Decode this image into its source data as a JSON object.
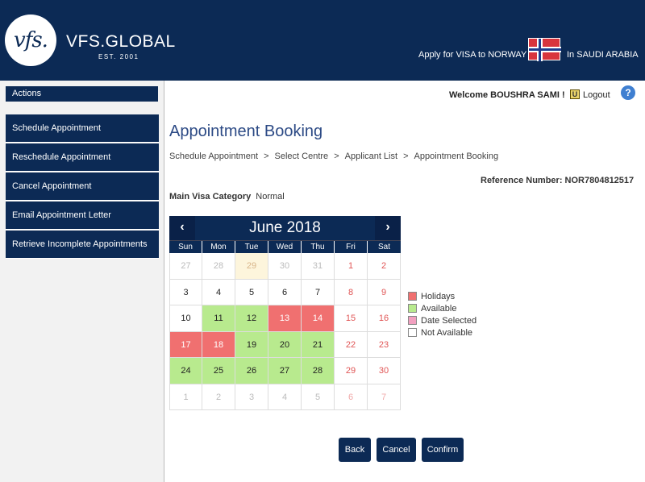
{
  "header": {
    "logo_mark": "vfs.",
    "brand": "VFS.GLOBAL",
    "brand_sub": "EST. 2001",
    "apply_text": "Apply for VISA to NORWAY",
    "in_text": "In SAUDI ARABIA",
    "flag_icon": "norway-flag-icon",
    "bg_color": "#0c2a55"
  },
  "sidebar": {
    "actions_label": "Actions",
    "items": [
      {
        "label": "Schedule Appointment"
      },
      {
        "label": "Reschedule Appointment"
      },
      {
        "label": "Cancel Appointment"
      },
      {
        "label": "Email Appointment Letter"
      },
      {
        "label": "Retrieve Incomplete Appointments"
      }
    ]
  },
  "topbar": {
    "welcome": "Welcome BOUSHRA SAMI !",
    "logout": "Logout",
    "logout_icon": "logout-icon",
    "help_icon": "help-icon"
  },
  "main": {
    "title": "Appointment Booking",
    "breadcrumb": [
      "Schedule Appointment",
      ">",
      "Select Centre",
      ">",
      "Applicant List",
      ">",
      "Appointment Booking"
    ],
    "reference": "Reference Number: NOR7804812517",
    "visa_category_label": "Main Visa Category",
    "visa_category_value": "Normal"
  },
  "calendar": {
    "prev_icon": "chevron-left-icon",
    "next_icon": "chevron-right-icon",
    "prev_glyph": "‹",
    "next_glyph": "›",
    "month_title": "June 2018",
    "days_of_week": [
      "Sun",
      "Mon",
      "Tue",
      "Wed",
      "Thu",
      "Fri",
      "Sat"
    ],
    "weeks": [
      [
        {
          "d": "27",
          "s": "other"
        },
        {
          "d": "28",
          "s": "other"
        },
        {
          "d": "29",
          "s": "other-tint"
        },
        {
          "d": "30",
          "s": "other"
        },
        {
          "d": "31",
          "s": "other"
        },
        {
          "d": "1",
          "s": "weekend"
        },
        {
          "d": "2",
          "s": "weekend"
        }
      ],
      [
        {
          "d": "3",
          "s": "na"
        },
        {
          "d": "4",
          "s": "na"
        },
        {
          "d": "5",
          "s": "na"
        },
        {
          "d": "6",
          "s": "na"
        },
        {
          "d": "7",
          "s": "na"
        },
        {
          "d": "8",
          "s": "weekend"
        },
        {
          "d": "9",
          "s": "weekend"
        }
      ],
      [
        {
          "d": "10",
          "s": "na"
        },
        {
          "d": "11",
          "s": "available"
        },
        {
          "d": "12",
          "s": "available"
        },
        {
          "d": "13",
          "s": "holiday"
        },
        {
          "d": "14",
          "s": "holiday"
        },
        {
          "d": "15",
          "s": "weekend"
        },
        {
          "d": "16",
          "s": "weekend"
        }
      ],
      [
        {
          "d": "17",
          "s": "holiday"
        },
        {
          "d": "18",
          "s": "holiday"
        },
        {
          "d": "19",
          "s": "available"
        },
        {
          "d": "20",
          "s": "available"
        },
        {
          "d": "21",
          "s": "available"
        },
        {
          "d": "22",
          "s": "weekend"
        },
        {
          "d": "23",
          "s": "weekend"
        }
      ],
      [
        {
          "d": "24",
          "s": "available"
        },
        {
          "d": "25",
          "s": "available"
        },
        {
          "d": "26",
          "s": "available"
        },
        {
          "d": "27",
          "s": "available"
        },
        {
          "d": "28",
          "s": "available"
        },
        {
          "d": "29",
          "s": "weekend"
        },
        {
          "d": "30",
          "s": "weekend"
        }
      ],
      [
        {
          "d": "1",
          "s": "other"
        },
        {
          "d": "2",
          "s": "other"
        },
        {
          "d": "3",
          "s": "other"
        },
        {
          "d": "4",
          "s": "other"
        },
        {
          "d": "5",
          "s": "other"
        },
        {
          "d": "6",
          "s": "other"
        },
        {
          "d": "7",
          "s": "other"
        }
      ]
    ]
  },
  "legend": [
    {
      "label": "Holidays",
      "color": "#f07070"
    },
    {
      "label": "Available",
      "color": "#b8ea8e"
    },
    {
      "label": "Date Selected",
      "color": "#f2a0c0"
    },
    {
      "label": "Not Available",
      "color": "#ffffff"
    }
  ],
  "buttons": {
    "back": "Back",
    "cancel": "Cancel",
    "confirm": "Confirm"
  }
}
